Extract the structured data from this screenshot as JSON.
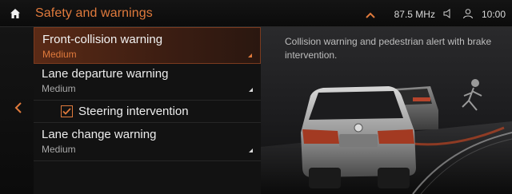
{
  "header": {
    "title": "Safety and warnings",
    "frequency": "87.5 MHz",
    "time": "10:00"
  },
  "menu": {
    "items": [
      {
        "label": "Front-collision warning",
        "value": "Medium",
        "selected": true
      },
      {
        "label": "Lane departure warning",
        "value": "Medium"
      },
      {
        "label": "Steering intervention",
        "checked": true
      },
      {
        "label": "Lane change warning",
        "value": "Medium"
      }
    ]
  },
  "panel": {
    "description": "Collision warning and pedestrian alert with brake intervention."
  },
  "colors": {
    "accent": "#e07a3c",
    "background": "#121212"
  },
  "icons": [
    "home-icon",
    "chevron-up-icon",
    "volume-icon",
    "user-icon",
    "back-chevron-icon",
    "checkmark-icon"
  ]
}
